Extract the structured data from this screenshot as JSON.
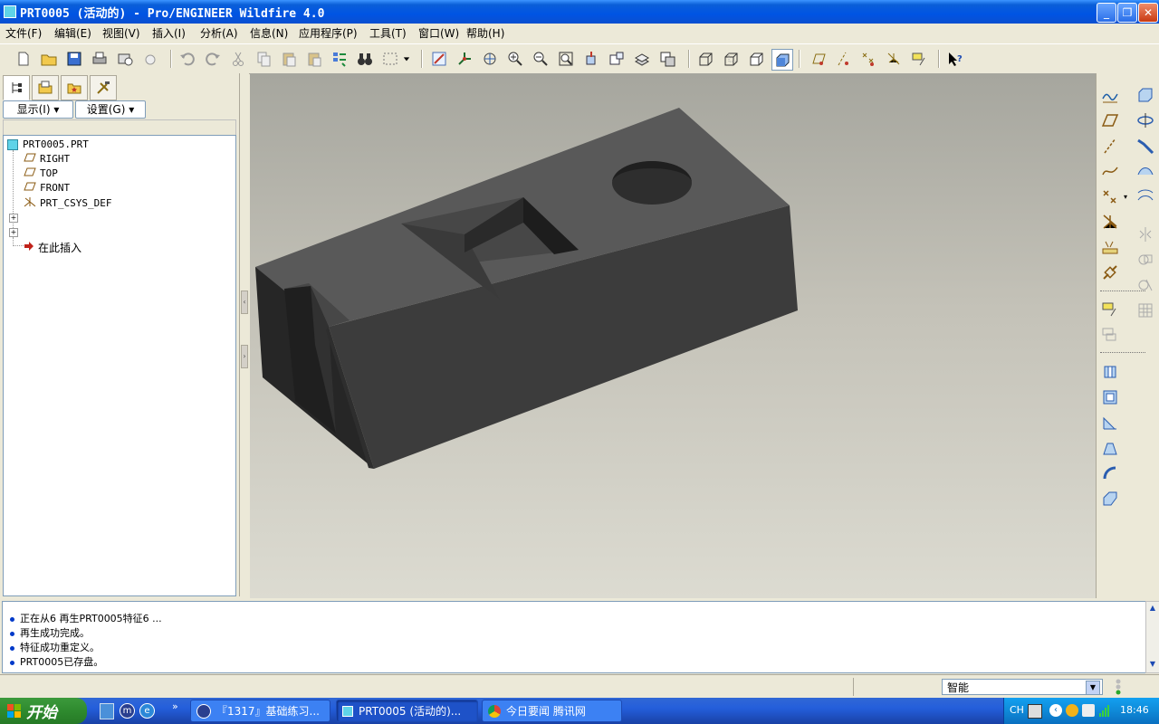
{
  "window": {
    "title": "PRT0005 (活动的) - Pro/ENGINEER Wildfire 4.0",
    "buttons": {
      "minimize": "_",
      "restore": "❐",
      "close": "✕"
    }
  },
  "menu": [
    "文件(F)",
    "编辑(E)",
    "视图(V)",
    "插入(I)",
    "分析(A)",
    "信息(N)",
    "应用程序(P)",
    "工具(T)",
    "窗口(W)",
    "帮助(H)"
  ],
  "left_panel": {
    "display_button": "显示(I) ▾",
    "settings_button": "设置(G) ▾",
    "tree": {
      "root": "PRT0005.PRT",
      "items": [
        "RIGHT",
        "TOP",
        "FRONT",
        "PRT_CSYS_DEF"
      ],
      "expanders": [
        "+",
        "+"
      ],
      "insert_here": "在此插入"
    }
  },
  "messages": [
    "正在从6 再生PRT0005特征6 ...",
    "再生成功完成。",
    "特征成功重定义。",
    "PRT0005已存盘。"
  ],
  "statusbar": {
    "filter_value": "智能"
  },
  "taskbar": {
    "start_label": "开始",
    "quicklaunch_more": "»",
    "items": [
      "『1317』基础练习...",
      "PRT0005 (活动的)...",
      "今日要闻 腾讯网"
    ],
    "tray": {
      "lang": "CH",
      "time": "18:46"
    }
  },
  "colors": {
    "titlebar": "#0054e3",
    "model_top": "#5a5a5a",
    "model_front": "#3e3e3e",
    "model_side": "#2c2c2c",
    "message_bullet": "#0039c9"
  }
}
